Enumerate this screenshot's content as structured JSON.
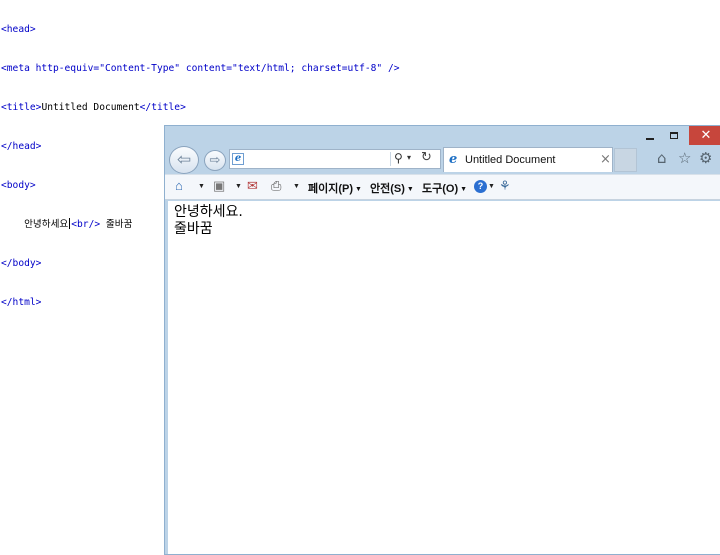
{
  "code": {
    "line1": "<head>",
    "line2": "<meta http-equiv=\"Content-Type\" content=\"text/html; charset=utf-8\" />",
    "line3_open": "<title>",
    "line3_text": "Untitled Document",
    "line3_close": "</title>",
    "line4": "</head>",
    "line5": "<body>",
    "line6_indent": "    ",
    "line6_text": "안녕하세요",
    "line6_tag": "<br/>",
    "line6_text2": "줄바꿈",
    "line7": "</body>",
    "line8": "</html>"
  },
  "browser": {
    "window_controls": {
      "minimize": "─",
      "maximize": "□",
      "close": "✕"
    },
    "address": {
      "value": "",
      "search_glyph": "⚲",
      "dropdown_glyph": "▾",
      "refresh_glyph": "↻"
    },
    "tab": {
      "title": "Untitled Document",
      "close_glyph": "×"
    },
    "command_bar": {
      "page_menu": "페이지(P)",
      "safety_menu": "안전(S)",
      "tools_menu": "도구(O)",
      "help_glyph": "?"
    },
    "page": {
      "line1": "안녕하세요.",
      "line2": "줄바꿈"
    }
  },
  "colors": {
    "tag_blue": "#0000c8",
    "window_frame": "#bcd3e7",
    "close_red": "#c7463c"
  }
}
